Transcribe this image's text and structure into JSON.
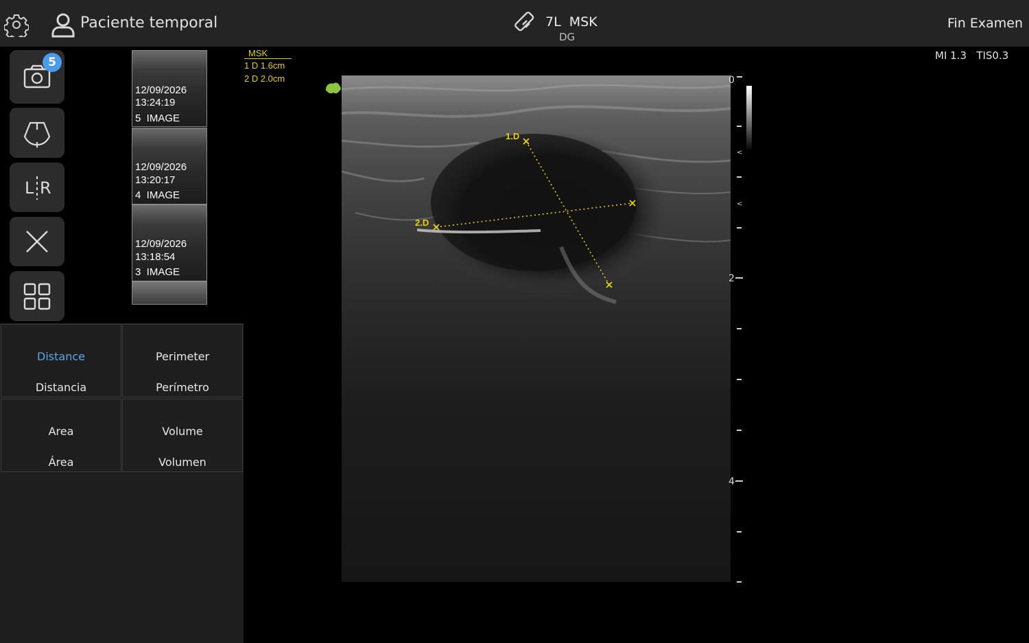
{
  "header": {
    "patient_name": "Paciente temporal",
    "probe": "7L  MSK",
    "preset": "DG",
    "end_exam": "Fin Examen"
  },
  "tools": {
    "image_count_badge": "5",
    "lr_label": "L R"
  },
  "thumbnails": [
    {
      "date": "12/09/2026",
      "time": "13:24:19",
      "label": "5  IMAGE"
    },
    {
      "date": "12/09/2026",
      "time": "13:20:17",
      "label": "4  IMAGE"
    },
    {
      "date": "12/09/2026",
      "time": "13:18:54",
      "label": "3  IMAGE"
    }
  ],
  "measure_tools": [
    {
      "en": "Distance",
      "es": "Distancia",
      "active": true
    },
    {
      "en": "Perimeter",
      "es": "Perímetro",
      "active": false
    },
    {
      "en": "Area",
      "es": "Área",
      "active": false
    },
    {
      "en": "Volume",
      "es": "Volumen",
      "active": false
    }
  ],
  "measurements": {
    "header": "MSK",
    "items": [
      "1 D 1.6cm",
      "2 D 2.0cm"
    ],
    "caliper_labels": [
      "1.D",
      "2.D"
    ]
  },
  "indices": {
    "mi": "MI 1.3",
    "tis": "TIS0.3"
  },
  "depth_scale": {
    "labels": [
      "0",
      "2",
      "4"
    ]
  },
  "colors": {
    "accent": "#5aa7ea",
    "badge": "#4a9be8",
    "caliper": "#e8d200",
    "topbar": "#242424"
  }
}
